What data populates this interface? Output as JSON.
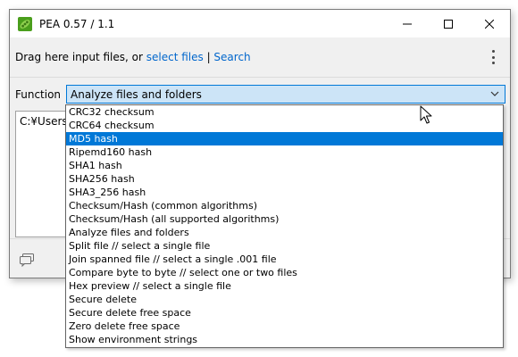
{
  "window": {
    "title": "PEA 0.57 / 1.1"
  },
  "toolbar": {
    "drop_text": "Drag here input files, or ",
    "select_files": "select files",
    "separator": " | ",
    "search": "Search"
  },
  "function": {
    "label": "Function",
    "selected": "Analyze files and folders"
  },
  "path_box": {
    "text": "C:¥Users¥"
  },
  "dropdown": {
    "items": [
      "CRC32 checksum",
      "CRC64 checksum",
      "MD5 hash",
      "Ripemd160 hash",
      "SHA1 hash",
      "SHA256 hash",
      "SHA3_256 hash",
      "Checksum/Hash (common algorithms)",
      "Checksum/Hash (all supported algorithms)",
      "Analyze files and folders",
      "Split file // select a single file",
      "Join spanned file // select a single .001 file",
      "Compare byte to byte // select one or two files",
      "Hex preview // select a single file",
      "Secure delete",
      "Secure delete free space",
      "Zero delete free space",
      "Show environment strings"
    ],
    "highlighted_index": 2
  },
  "colors": {
    "accent": "#0078d7",
    "link": "#0066cc",
    "combo_bg": "#cce4f7",
    "app_icon": "#6cbf2a"
  },
  "icons": {
    "app": "pea-pod-icon",
    "minimize": "minimize-icon",
    "maximize": "maximize-icon",
    "close": "close-icon",
    "menu": "kebab-menu-icon",
    "dropdown": "chevron-down-icon",
    "chat": "chat-bubbles-icon"
  }
}
